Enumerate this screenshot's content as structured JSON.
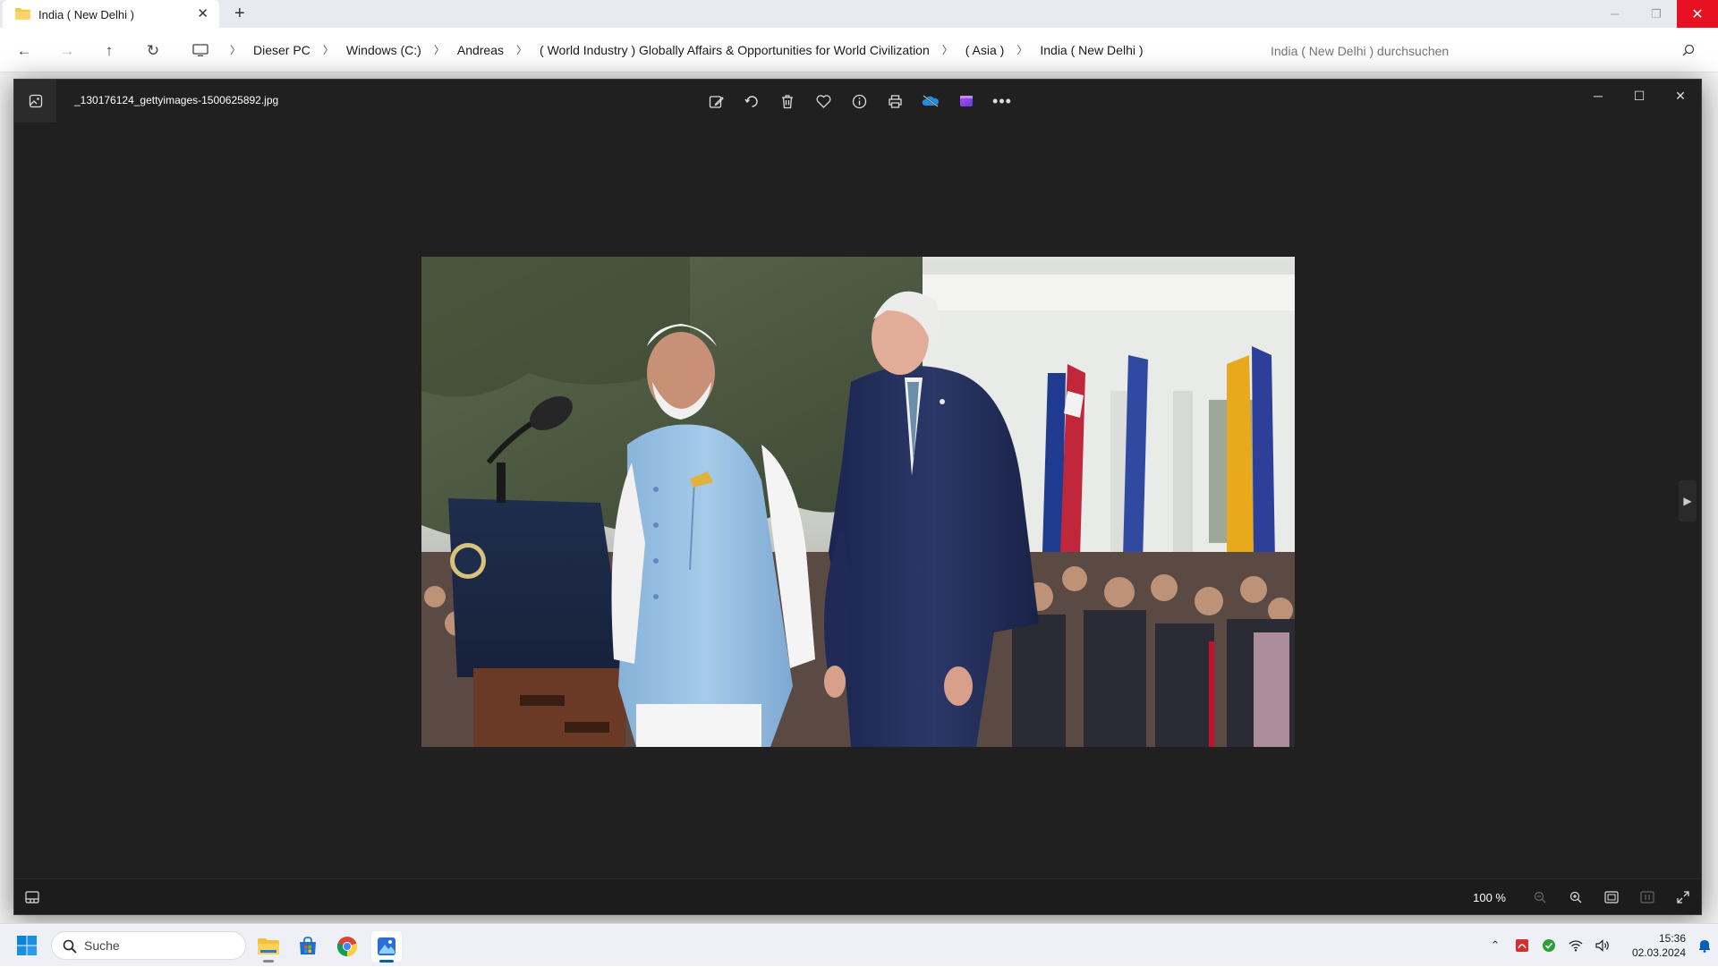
{
  "explorer": {
    "tab_title": "India ( New Delhi )",
    "breadcrumbs": [
      "Dieser PC",
      "Windows (C:)",
      "Andreas",
      "( World Industry ) Globally Affairs & Opportunities for World Civilization",
      "( Asia )",
      "India ( New Delhi )"
    ],
    "search_placeholder": "India ( New Delhi ) durchsuchen"
  },
  "viewer": {
    "filename": "_130176124_gettyimages-1500625892.jpg",
    "toolbar": [
      "edit-image-icon",
      "rotate-icon",
      "delete-icon",
      "favorite-icon",
      "info-icon",
      "print-icon",
      "onedrive-icon",
      "clipchamp-icon",
      "more-icon"
    ],
    "zoom": "100 %",
    "photo_description_colors": {
      "sky": "#e7e8e6",
      "vest": "#9cc3e4",
      "suit": "#232e57"
    }
  },
  "taskbar": {
    "search_label": "Suche",
    "apps": [
      "file-explorer-icon",
      "microsoft-store-icon",
      "chrome-icon",
      "photos-icon"
    ],
    "time": "15:36",
    "date": "02.03.2024"
  },
  "colors": {
    "viewer_bg": "#202020",
    "close_red": "#e81123",
    "accent": "#005fb8"
  }
}
